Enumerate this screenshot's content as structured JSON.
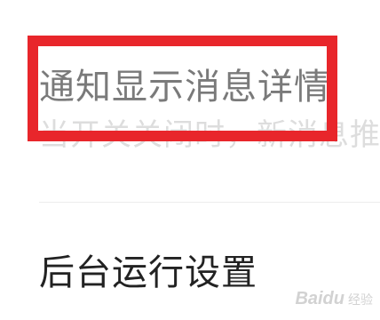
{
  "settings": {
    "notification_detail": {
      "title": "通知显示消息详情",
      "description": "当开关关闭时，新消息推送"
    },
    "background_run": {
      "title": "后台运行设置"
    }
  },
  "highlight": {
    "color": "#e8262b"
  },
  "watermark": {
    "logo": "Baidu",
    "sub": "经验"
  }
}
